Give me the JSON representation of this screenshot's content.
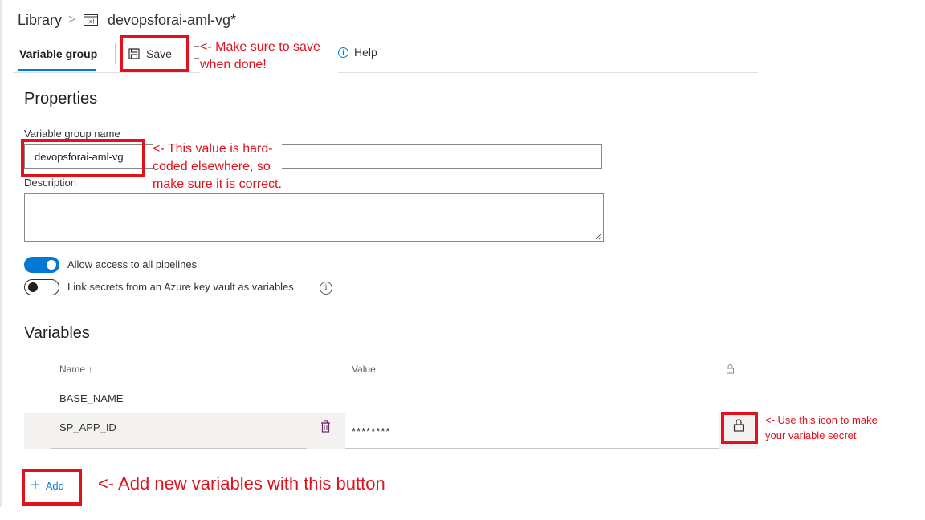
{
  "breadcrumb": {
    "root": "Library",
    "separator": ">",
    "title": "devopsforai-aml-vg*"
  },
  "toolbar": {
    "tab_label": "Variable group",
    "save_label": "Save",
    "help_label": "Help"
  },
  "properties": {
    "heading": "Properties",
    "name_label": "Variable group name",
    "name_value": "devopsforai-aml-vg",
    "description_label": "Description",
    "description_value": "",
    "toggles": [
      {
        "label": "Allow access to all pipelines",
        "on": true
      },
      {
        "label": "Link secrets from an Azure key vault as variables",
        "on": false
      }
    ],
    "info_glyph": "i"
  },
  "variables": {
    "heading": "Variables",
    "columns": {
      "name": "Name ↑",
      "value": "Value"
    },
    "rows": [
      {
        "name": "BASE_NAME",
        "value": ""
      },
      {
        "name": "SP_APP_ID",
        "value": "********"
      }
    ],
    "add_label": "Add"
  },
  "annotations": {
    "save_line1": "<- Make sure to save",
    "save_line2": "when done!",
    "name_line1": "<- This value is hard-",
    "name_line2": "coded elsewhere, so",
    "name_line3": "make sure it is correct.",
    "lock_line1": "<- Use this icon to make",
    "lock_line2": "your variable secret",
    "add_note": "<- Add new variables with this button"
  },
  "colors": {
    "accent": "#0078d4",
    "annotation_red": "#e3101d",
    "row_hover": "#f3f2f1"
  },
  "icons": [
    "chevron-right",
    "variable-group-icon",
    "floppy-disk-icon",
    "help-icon",
    "info-icon",
    "lock-icon",
    "trash-icon",
    "plus-icon"
  ]
}
